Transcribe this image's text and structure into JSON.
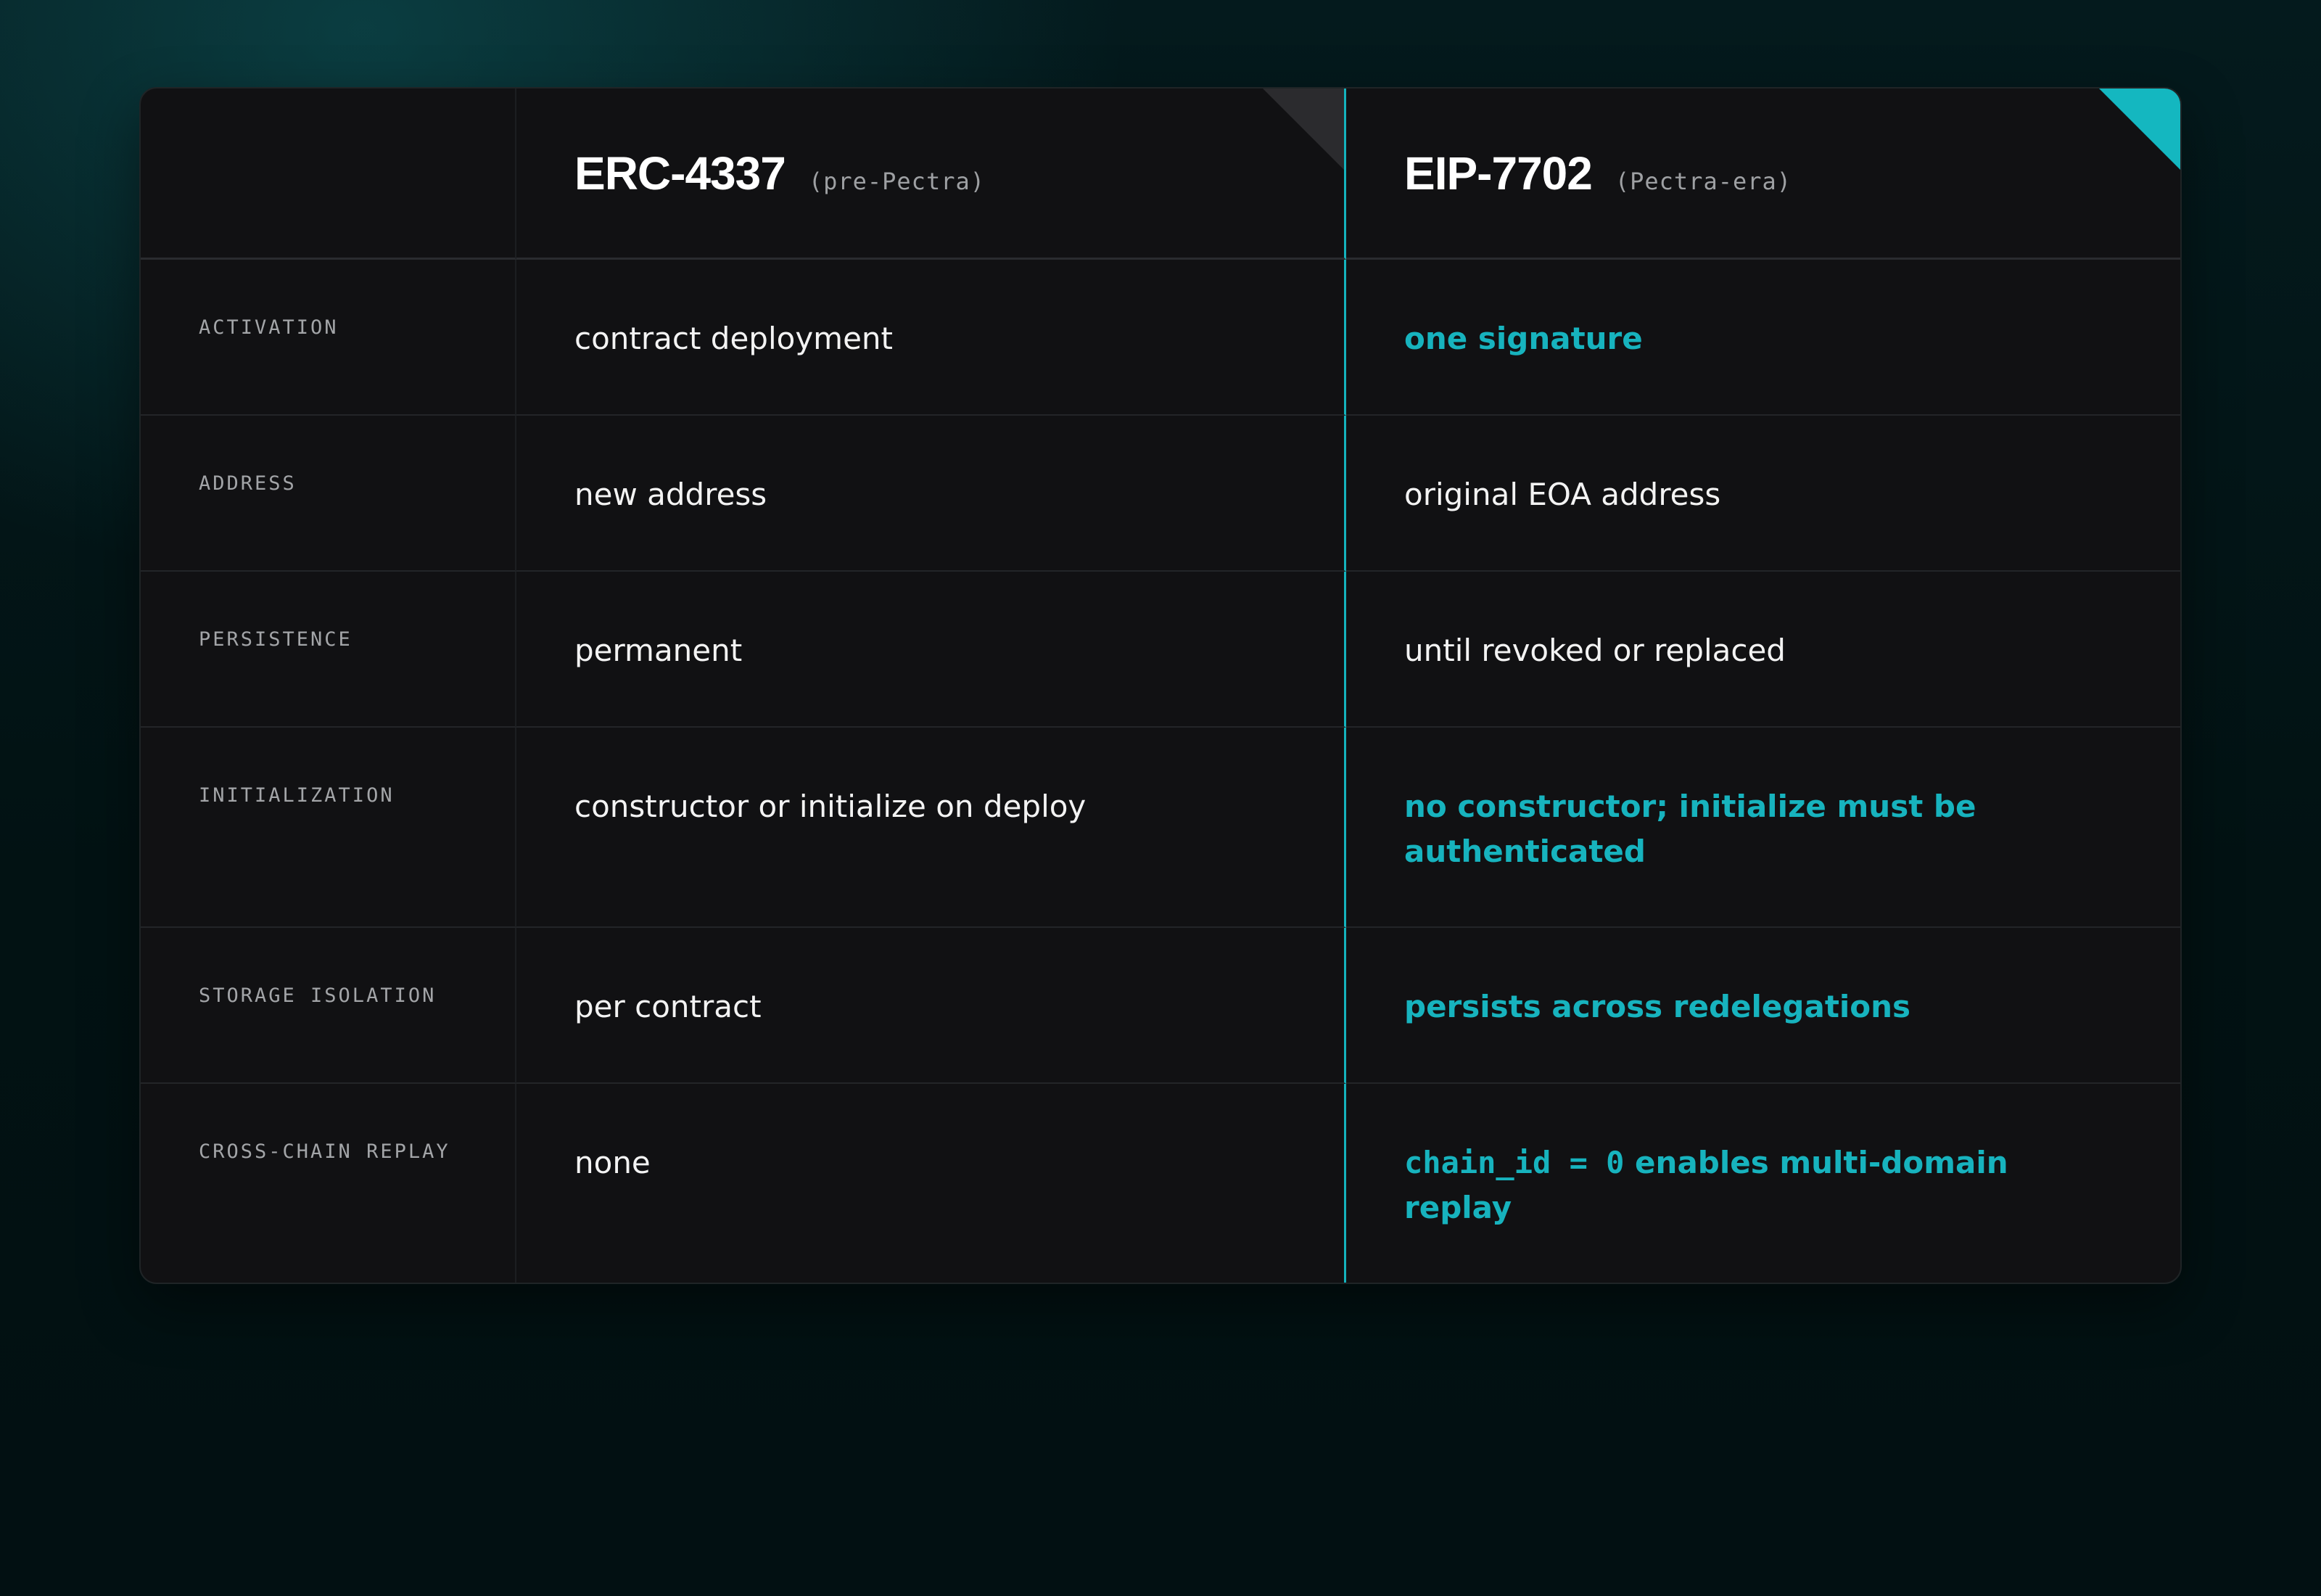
{
  "columns": [
    {
      "title": "ERC-4337",
      "subtitle": "(pre-Pectra)"
    },
    {
      "title": "EIP-7702",
      "subtitle": "(Pectra-era)"
    }
  ],
  "rows": [
    {
      "label": "ACTIVATION",
      "erc4337": "contract deployment",
      "eip7702": "one signature",
      "eip7702_highlight": true
    },
    {
      "label": "ADDRESS",
      "erc4337": "new address",
      "eip7702": "original EOA address",
      "eip7702_highlight": false
    },
    {
      "label": "PERSISTENCE",
      "erc4337": "permanent",
      "eip7702": "until revoked or replaced",
      "eip7702_highlight": false
    },
    {
      "label": "INITIALIZATION",
      "erc4337": "constructor or initialize on deploy",
      "eip7702": "no constructor; initialize must be authenticated",
      "eip7702_highlight": true
    },
    {
      "label": "STORAGE ISOLATION",
      "erc4337": "per contract",
      "eip7702": "persists across redelegations",
      "eip7702_highlight": true
    },
    {
      "label": "CROSS-CHAIN REPLAY",
      "erc4337": "none",
      "eip7702_code": "chain_id = 0",
      "eip7702": " enables multi-domain replay",
      "eip7702_highlight": true
    }
  ],
  "colors": {
    "accent": "#17b3be",
    "card_bg": "#111113",
    "text": "#f3f3f3",
    "label": "#a3a5a8"
  }
}
